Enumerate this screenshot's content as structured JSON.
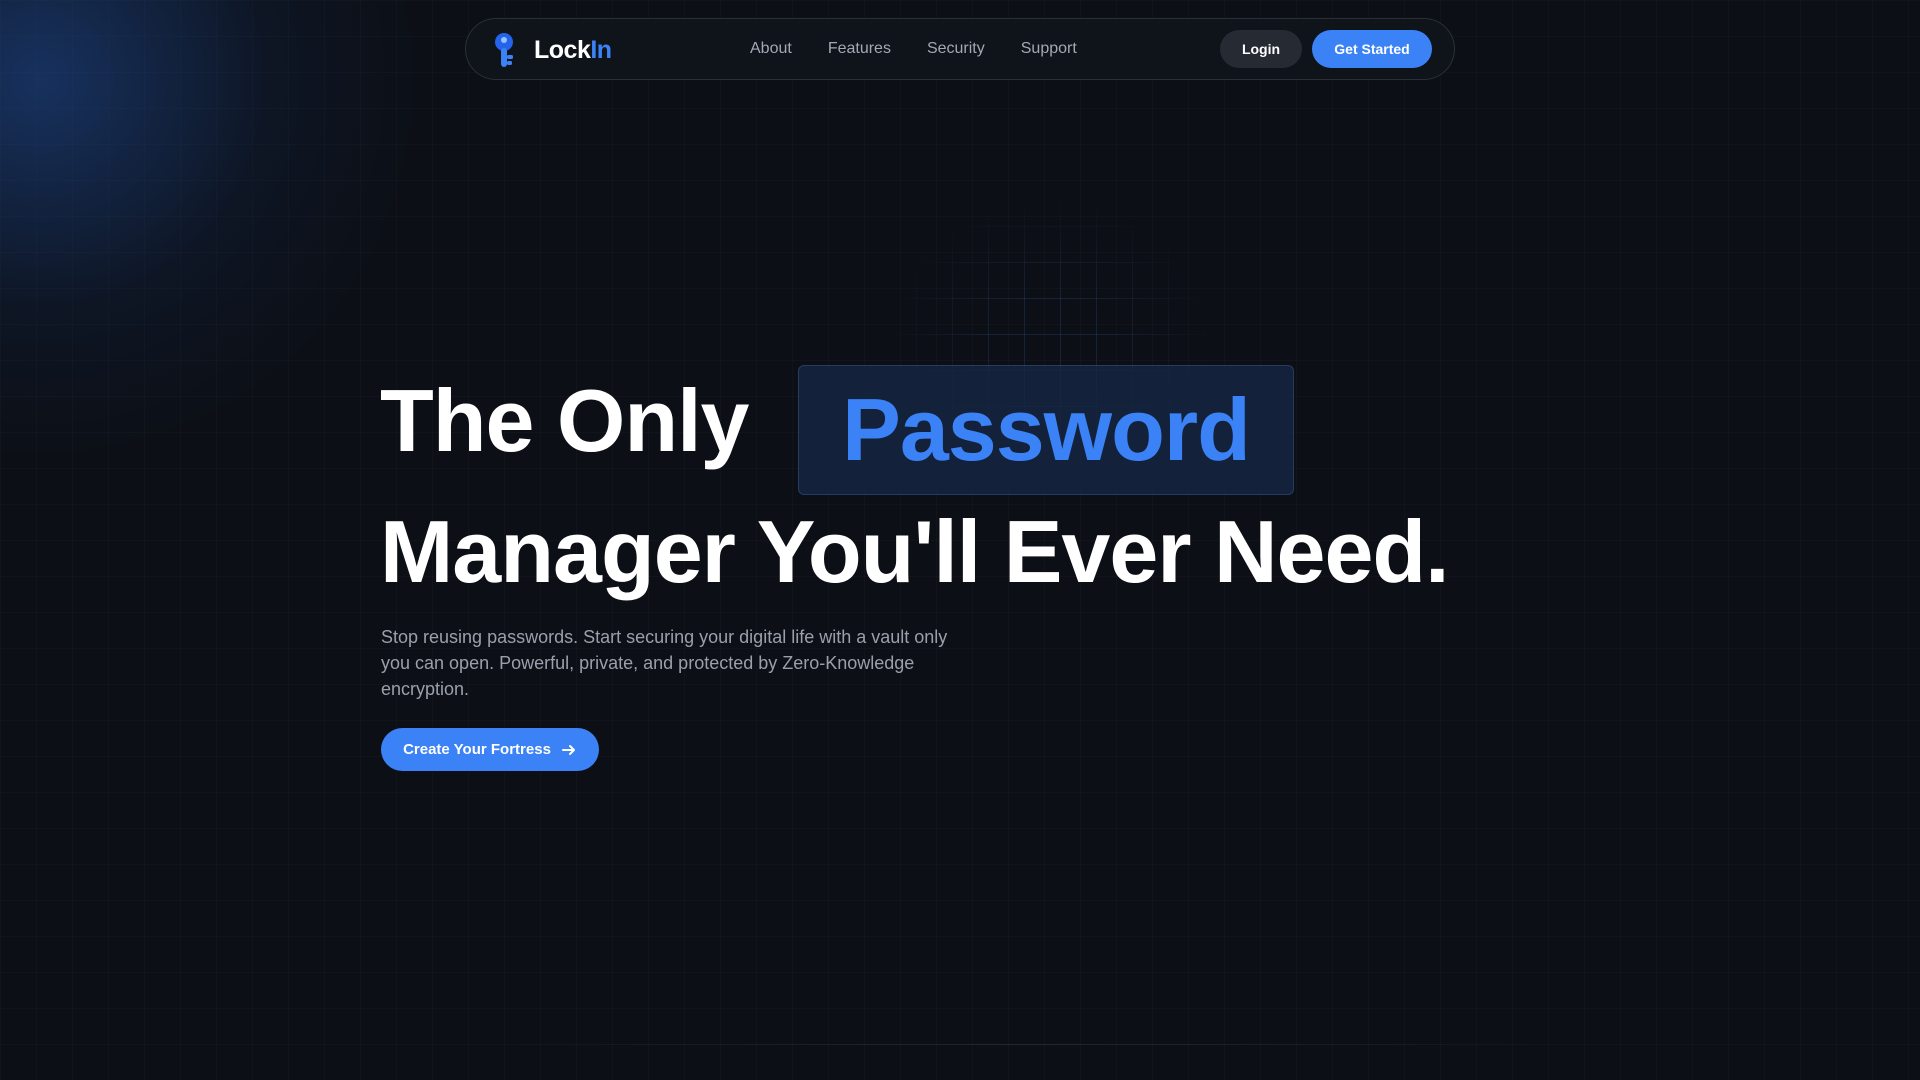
{
  "brand": {
    "name_part1": "Lock",
    "name_part2": "In",
    "accent": "#3b82f6",
    "logo_icon": "key-icon"
  },
  "nav": {
    "links": [
      "About",
      "Features",
      "Security",
      "Support"
    ],
    "login_label": "Login",
    "get_started_label": "Get Started"
  },
  "hero": {
    "line1": "The Only",
    "highlight": "Password",
    "line2": "Manager You'll Ever Need.",
    "subtext": "Stop reusing passwords. Start securing your digital life with a vault only you can open. Powerful, private, and protected by Zero-Knowledge encryption.",
    "cta_label": "Create Your Fortress",
    "cta_icon": "arrow-right-icon"
  },
  "colors": {
    "background": "#0c0f15",
    "accent": "#3b82f6",
    "text_muted": "#9aa0ab"
  }
}
